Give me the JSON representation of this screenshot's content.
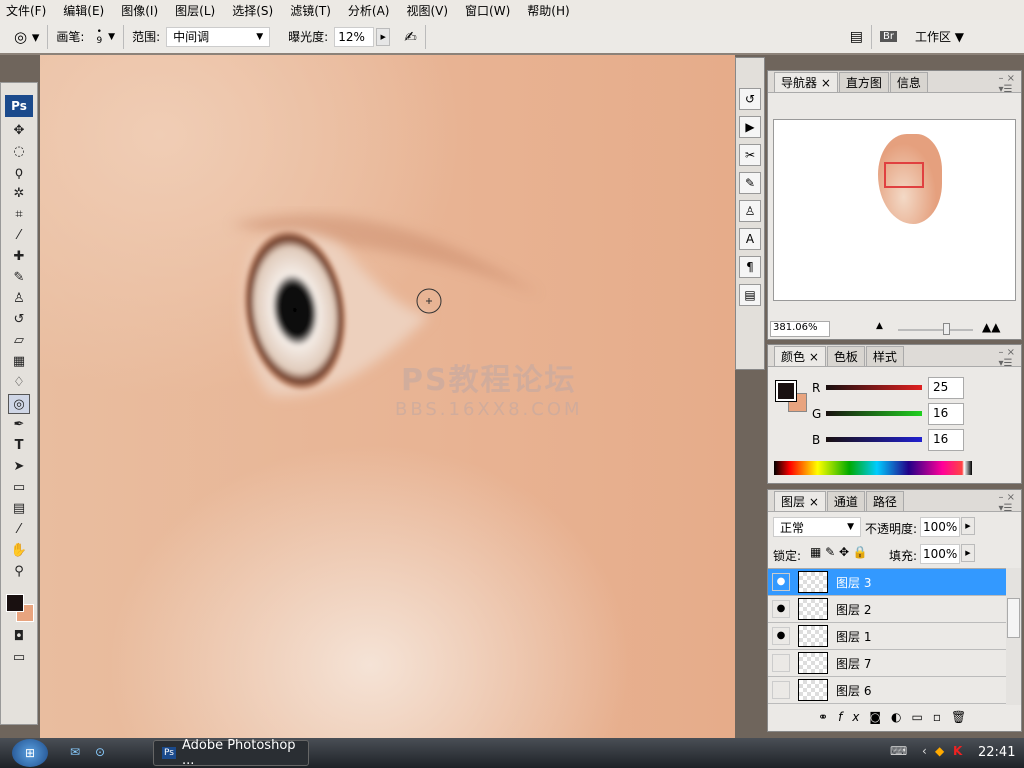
{
  "menu": [
    "文件(F)",
    "编辑(E)",
    "图像(I)",
    "图层(L)",
    "选择(S)",
    "滤镜(T)",
    "分析(A)",
    "视图(V)",
    "窗口(W)",
    "帮助(H)"
  ],
  "options": {
    "brush_label": "画笔:",
    "brush_size": "9",
    "range_label": "范围:",
    "range_value": "中间调",
    "exposure_label": "曝光度:",
    "exposure_value": "12%",
    "workspace": "工作区 ▼"
  },
  "toolbox": {
    "logo": "Ps"
  },
  "watermark": {
    "line1": "PS教程论坛",
    "line2": "BBS.16XX8.COM"
  },
  "navigator": {
    "tabs": [
      "导航器",
      "直方图",
      "信息"
    ],
    "zoom": "381.06%"
  },
  "color": {
    "tabs": [
      "颜色",
      "色板",
      "样式"
    ],
    "r_label": "R",
    "g_label": "G",
    "b_label": "B",
    "r": "25",
    "g": "16",
    "b": "16",
    "foreground": "#191010",
    "background": "#e8a47f"
  },
  "layers": {
    "tabs": [
      "图层",
      "通道",
      "路径"
    ],
    "blend": "正常",
    "opacity_label": "不透明度:",
    "opacity": "100%",
    "lock_label": "锁定:",
    "fill_label": "填充:",
    "fill": "100%",
    "items": [
      {
        "name": "图层 3",
        "visible": true,
        "selected": true
      },
      {
        "name": "图层 2",
        "visible": true
      },
      {
        "name": "图层 1",
        "visible": true
      },
      {
        "name": "图层 7",
        "visible": false
      },
      {
        "name": "图层 6",
        "visible": false
      }
    ]
  },
  "taskbar": {
    "app": "Adobe Photoshop ...",
    "app_icon": "Ps",
    "clock": "22:41"
  }
}
